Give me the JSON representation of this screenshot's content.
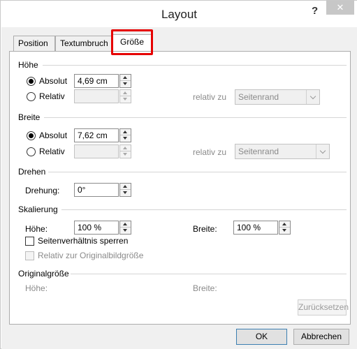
{
  "window": {
    "title": "Layout",
    "help_label": "?",
    "close_label": "✕"
  },
  "tabs": [
    {
      "label": "Position"
    },
    {
      "label": "Textumbruch"
    },
    {
      "label": "Größe"
    }
  ],
  "hoehe": {
    "section": "Höhe",
    "absolut_label": "Absolut",
    "absolut_value": "4,69 cm",
    "relativ_label": "Relativ",
    "relativ_value": "",
    "relativ_zu_label": "relativ zu",
    "relativ_zu_value": "Seitenrand"
  },
  "breite": {
    "section": "Breite",
    "absolut_label": "Absolut",
    "absolut_value": "7,62 cm",
    "relativ_label": "Relativ",
    "relativ_value": "",
    "relativ_zu_label": "relativ zu",
    "relativ_zu_value": "Seitenrand"
  },
  "drehen": {
    "section": "Drehen",
    "drehung_label": "Drehung:",
    "drehung_value": "0°"
  },
  "skalierung": {
    "section": "Skalierung",
    "hoehe_label": "Höhe:",
    "hoehe_value": "100 %",
    "breite_label": "Breite:",
    "breite_value": "100 %",
    "lock_label": "Seitenverhältnis sperren",
    "relative_label": "Relativ zur Originalbildgröße"
  },
  "original": {
    "section": "Originalgröße",
    "hoehe_label": "Höhe:",
    "breite_label": "Breite:",
    "reset_label": "Zurücksetzen"
  },
  "buttons": {
    "ok": "OK",
    "cancel": "Abbrechen"
  }
}
